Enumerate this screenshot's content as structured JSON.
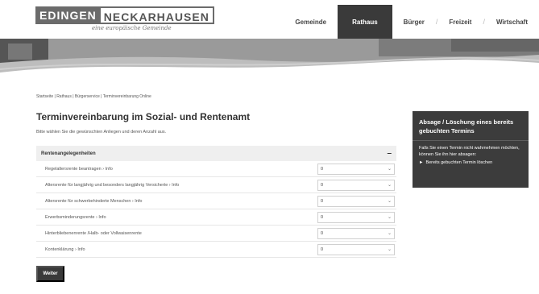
{
  "header": {
    "logo_part1": "EDINGEN",
    "logo_part2": "NECKARHAUSEN",
    "logo_tagline": "eine europäische Gemeinde",
    "nav": [
      {
        "label": "Gemeinde"
      },
      {
        "label": "Rathaus"
      },
      {
        "label": "Bürger"
      },
      {
        "label": "Freizeit"
      },
      {
        "label": "Wirtschaft"
      }
    ]
  },
  "breadcrumb": "Startseite | Rathaus | Bürgerservice | Terminvereinbarung Online",
  "page_title": "Terminvereinbarung im Sozial- und Rentenamt",
  "intro": "Bitte wählen Sie die gewünschten Anliegen und deren Anzahl aus.",
  "accordion": {
    "title": "Rentenangelegenheiten",
    "toggle": "–",
    "rows": [
      {
        "label": "Regelaltersrente beantragen  › Info",
        "value": "0"
      },
      {
        "label": "Altersrente für langjährig und besonders langjährig Versicherte  › Info",
        "value": "0"
      },
      {
        "label": "Altersrente für schwerbehinderte Menschen  › Info",
        "value": "0"
      },
      {
        "label": "Erwerbsminderungsrente  › Info",
        "value": "0"
      },
      {
        "label": "Hinterbliebenenrente /Halb- oder Vollwaisenrente",
        "value": "0"
      },
      {
        "label": "Kontenklärung  › Info",
        "value": "0"
      }
    ]
  },
  "submit_label": "Weiter",
  "sidebox": {
    "title": "Absage / Löschung eines bereits gebuchten Termins",
    "text": "Falls Sie einen Termin nicht wahrnehmen möchten, können Sie ihn hier absagen:",
    "link_arrow": "►",
    "link_label": "Bereits gebuchten Termin löschen"
  },
  "colors": {
    "dark": "#3a3a3a",
    "sidebox": "#3c3c3c",
    "accordion_header": "#efefef"
  }
}
